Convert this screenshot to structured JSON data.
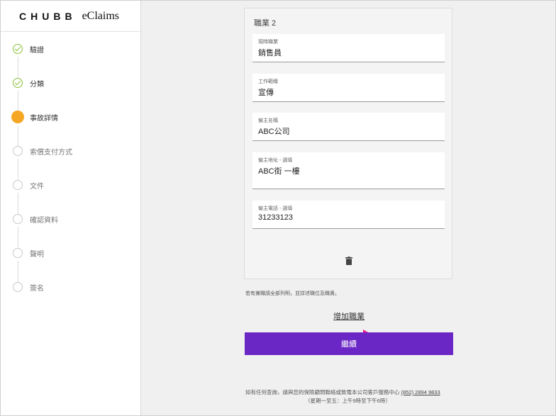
{
  "brand": {
    "logo": "CHUBB",
    "product": "eClaims"
  },
  "sidebar": {
    "steps": [
      {
        "label": "驗證",
        "state": "done"
      },
      {
        "label": "分類",
        "state": "done"
      },
      {
        "label": "事故詳情",
        "state": "active"
      },
      {
        "label": "索償支付方式",
        "state": "pending"
      },
      {
        "label": "文件",
        "state": "pending"
      },
      {
        "label": "確認資料",
        "state": "pending"
      },
      {
        "label": "聲明",
        "state": "pending"
      },
      {
        "label": "簽名",
        "state": "pending"
      }
    ]
  },
  "occupation_card": {
    "title": "職業 2",
    "fields": [
      {
        "label": "現時職業",
        "value": "銷售員"
      },
      {
        "label": "工作範疇",
        "value": "宣傳"
      },
      {
        "label": "僱主名稱",
        "value": "ABC公司"
      },
      {
        "label": "僱主地址 - 選填",
        "value": "ABC街 一樓"
      },
      {
        "label": "僱主電話 - 選填",
        "value": "31233123"
      }
    ],
    "delete_icon": "trash-icon"
  },
  "note": "若有兼職請全部列明，並詳述職位及職責。",
  "add_occupation_label": "增加職業",
  "continue_label": "繼續",
  "footer": {
    "line1_prefix": "如有任何查詢，請與您的保險顧問聯絡或致電本公司客戶服務中心",
    "phone": "(852) 2894 9833",
    "line2": "（星期一至五：上午9時至下午6時）"
  },
  "colors": {
    "accent": "#6b26c6",
    "active_step": "#f5a623",
    "done_step": "#8bbf3a",
    "arrow": "#f0148c"
  }
}
